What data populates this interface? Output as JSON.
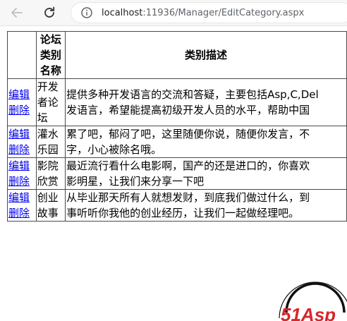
{
  "browser": {
    "url_host": "localhost",
    "url_rest": ":11936/Manager/EditCategory.aspx"
  },
  "table": {
    "headers": [
      "",
      "论坛类别名称",
      "类别描述"
    ],
    "rows": [
      {
        "edit_label": "编辑",
        "delete_label": "删除",
        "name": "开发者论坛",
        "desc_line1": "提供多种开发语言的交流和答疑，主要包括Asp,C,Del",
        "desc_line2": "发语言，希望能提高初级开发人员的水平，帮助中国"
      },
      {
        "edit_label": "编辑",
        "delete_label": "删除",
        "name": "灌水乐园",
        "desc_line1": "累了吧，郁闷了吧，这里随便你说，随便你发言，不",
        "desc_line2": "字，小心被除名哦。"
      },
      {
        "edit_label": "编辑",
        "delete_label": "删除",
        "name": "影院欣赏",
        "desc_line1": "最近流行看什么电影啊，国产的还是进口的，你喜欢",
        "desc_line2": "影明星，让我们来分享一下吧"
      },
      {
        "edit_label": "编辑",
        "delete_label": "删除",
        "name": "创业故事",
        "desc_line1": "从毕业那天所有人就想发财，到底我们做过什么，到",
        "desc_line2": "事听听你我他的创业经历，让我们一起做经理吧。"
      }
    ]
  },
  "logo": {
    "text": "51Asp",
    "color": "#d7262b"
  }
}
